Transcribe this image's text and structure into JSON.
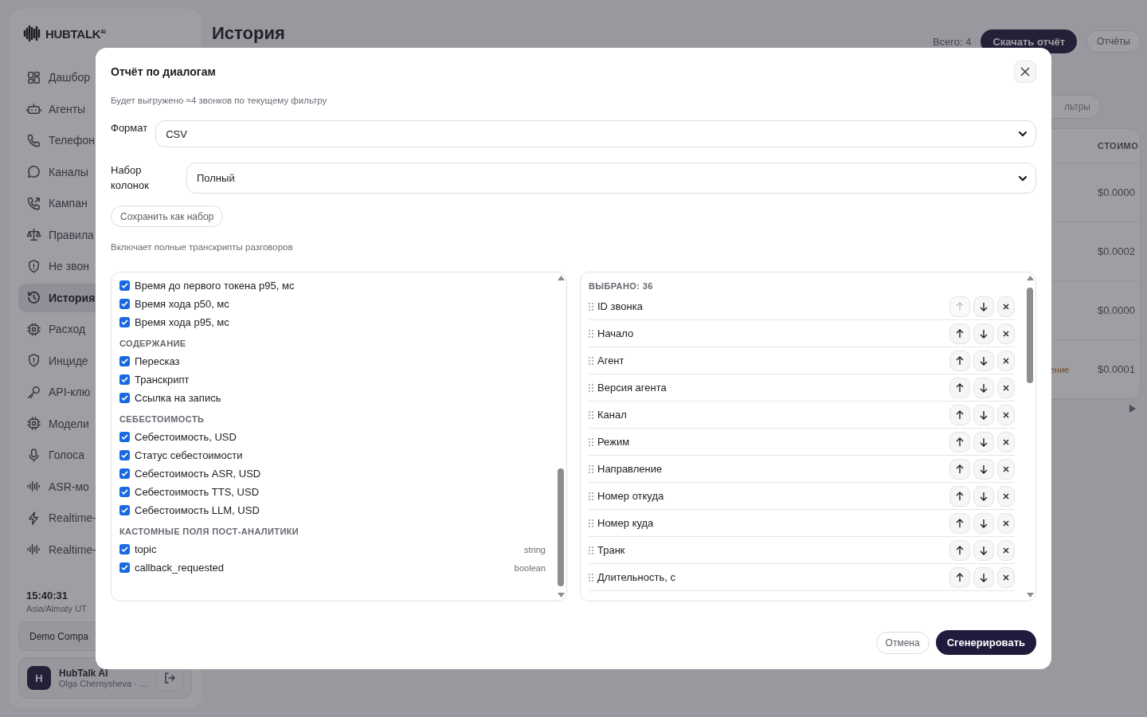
{
  "sidebar": {
    "logo": "HUBTALK$^{AI}$",
    "items": [
      {
        "label": "Дашбор",
        "selected": false
      },
      {
        "label": "Агенты",
        "selected": false
      },
      {
        "label": "Телефон",
        "selected": false
      },
      {
        "label": "Каналы",
        "selected": false
      },
      {
        "label": "Кампан",
        "selected": false
      },
      {
        "label": "Правила",
        "selected": false
      },
      {
        "label": "Не звон",
        "selected": false
      },
      {
        "label": "История",
        "selected": true
      },
      {
        "label": "Расход",
        "selected": false
      },
      {
        "label": "Инциде",
        "selected": false
      },
      {
        "label": "API-клю",
        "selected": false
      },
      {
        "label": "Модели",
        "selected": false
      },
      {
        "label": "Голоса",
        "selected": false
      },
      {
        "label": "ASR-мо",
        "selected": false
      },
      {
        "label": "Realtime-",
        "selected": false
      },
      {
        "label": "Realtime-",
        "selected": false
      }
    ],
    "clock": "15:40:31",
    "timezone": "Asia/Almaty UT",
    "company": "Demo Compa",
    "user": {
      "avatar": "H",
      "name": "HubTalk AI",
      "subtitle": "Olga Chernysheva · …"
    }
  },
  "header": {
    "title": "История",
    "total": "Всего: 4",
    "download_button": "Скачать отчёт",
    "reports_button": "Отчёты"
  },
  "filter_chip": "льтры",
  "table": {
    "columns": [
      "СТОИМО"
    ],
    "rows": [
      {
        "cost": "$0.0000"
      },
      {
        "cost": "$0.0002"
      },
      {
        "cost": "$0.0000"
      },
      {
        "status": "ение",
        "cost": "$0.0001"
      }
    ]
  },
  "modal": {
    "title": "Отчёт по диалогам",
    "subtitle": "Будет выгружено ≈4 звонков по текущему фильтру",
    "format": {
      "label": "Формат",
      "value": "CSV"
    },
    "column_set": {
      "label": "Набор колонок",
      "value": "Полный"
    },
    "save_button": "Сохранить как набор",
    "note": "Включает полные транскрипты разговоров",
    "available": [
      {
        "items": [
          {
            "label": "Время до первого токена p95, мс",
            "checked": true
          },
          {
            "label": "Время хода p50, мс",
            "checked": true
          },
          {
            "label": "Время хода p95, мс",
            "checked": true
          }
        ]
      },
      {
        "heading": "СОДЕРЖАНИЕ",
        "items": [
          {
            "label": "Пересказ",
            "checked": true
          },
          {
            "label": "Транскрипт",
            "checked": true
          },
          {
            "label": "Ссылка на запись",
            "checked": true
          }
        ]
      },
      {
        "heading": "СЕБЕСТОИМОСТЬ",
        "items": [
          {
            "label": "Себестоимость, USD",
            "checked": true
          },
          {
            "label": "Статус себестоимости",
            "checked": true
          },
          {
            "label": "Себестоимость ASR, USD",
            "checked": true
          },
          {
            "label": "Себестоимость TTS, USD",
            "checked": true
          },
          {
            "label": "Себестоимость LLM, USD",
            "checked": true
          }
        ]
      },
      {
        "heading": "КАСТОМНЫЕ ПОЛЯ ПОСТ-АНАЛИТИКИ",
        "items": [
          {
            "label": "topic",
            "checked": true,
            "type": "string"
          },
          {
            "label": "callback_requested",
            "checked": true,
            "type": "boolean"
          }
        ]
      }
    ],
    "selected": {
      "heading": "ВЫБРАНО: 36",
      "items": [
        {
          "label": "ID звонка",
          "up_disabled": true
        },
        {
          "label": "Начало",
          "up_disabled": false
        },
        {
          "label": "Агент",
          "up_disabled": false
        },
        {
          "label": "Версия агента",
          "up_disabled": false
        },
        {
          "label": "Канал",
          "up_disabled": false
        },
        {
          "label": "Режим",
          "up_disabled": false
        },
        {
          "label": "Направление",
          "up_disabled": false
        },
        {
          "label": "Номер откуда",
          "up_disabled": false
        },
        {
          "label": "Номер куда",
          "up_disabled": false
        },
        {
          "label": "Транк",
          "up_disabled": false
        },
        {
          "label": "Длительность, с",
          "up_disabled": false
        }
      ]
    },
    "cancel_button": "Отмена",
    "generate_button": "Сгенерировать"
  }
}
